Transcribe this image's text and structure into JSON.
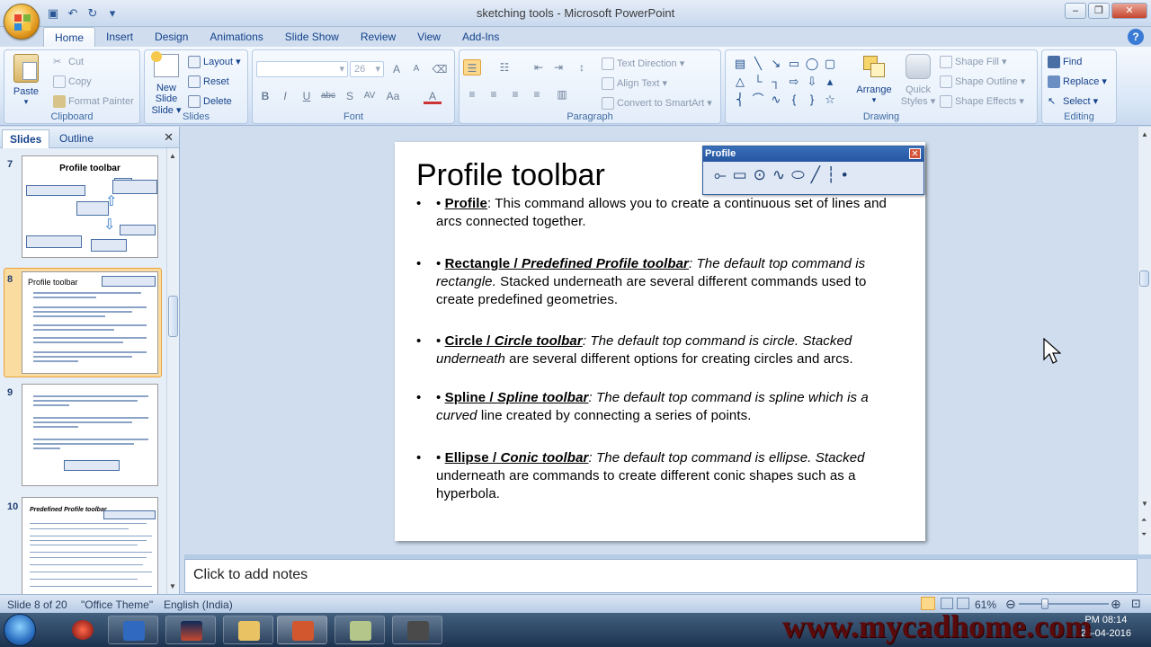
{
  "window": {
    "title": "sketching tools - Microsoft PowerPoint"
  },
  "tabs": [
    "Home",
    "Insert",
    "Design",
    "Animations",
    "Slide Show",
    "Review",
    "View",
    "Add-Ins"
  ],
  "active_tab": "Home",
  "ribbon": {
    "clipboard": {
      "label": "Clipboard",
      "paste": "Paste",
      "cut": "Cut",
      "copy": "Copy",
      "format_painter": "Format Painter"
    },
    "slides": {
      "label": "Slides",
      "new_slide": "New Slide",
      "new_slide_2": "Slide",
      "layout": "Layout",
      "reset": "Reset",
      "delete": "Delete"
    },
    "font": {
      "label": "Font",
      "font_name": "",
      "font_size": "26"
    },
    "paragraph": {
      "label": "Paragraph",
      "text_direction": "Text Direction",
      "align_text": "Align Text",
      "convert_smartart": "Convert to SmartArt"
    },
    "drawing": {
      "label": "Drawing",
      "arrange": "Arrange",
      "quick_styles": "Quick",
      "quick_styles_2": "Styles",
      "shape_fill": "Shape Fill",
      "shape_outline": "Shape Outline",
      "shape_effects": "Shape Effects"
    },
    "editing": {
      "label": "Editing",
      "find": "Find",
      "replace": "Replace",
      "select": "Select"
    }
  },
  "left_pane": {
    "tabs": [
      "Slides",
      "Outline"
    ],
    "slides": [
      {
        "num": "7",
        "title": "Profile toolbar"
      },
      {
        "num": "8",
        "title": "Profile toolbar"
      },
      {
        "num": "9",
        "title": ""
      },
      {
        "num": "10",
        "title": "Predefined Profile toolbar"
      }
    ]
  },
  "slide": {
    "title": "Profile toolbar",
    "bullets": [
      {
        "term": "Profile",
        "text_parts": [
          ": This command allows you to create a continuous set of lines and arcs connected together."
        ]
      },
      {
        "term": "Rectangle / ",
        "term_i": "Predefined Profile toolbar",
        "italic": ": The default top command is rectangle.",
        "text": " Stacked underneath are several different commands used to create predefined geometries."
      },
      {
        "term": "Circle / ",
        "term_i": "Circle toolbar",
        "italic": ": The default top command is circle. Stacked underneath",
        "text": " are several different options for creating circles and arcs."
      },
      {
        "term": "Spline / ",
        "term_i": "Spline toolbar",
        "italic": ": The default top command is spline which is a curved",
        "text": " line created by connecting a series of points."
      },
      {
        "term": "Ellipse / ",
        "term_i": "Conic toolbar",
        "italic": ": The default top command is ellipse. Stacked",
        "text": " underneath are commands to create different conic shapes such as a hyperbola."
      }
    ]
  },
  "floating_toolbar": {
    "title": "Profile"
  },
  "notes": {
    "placeholder": "Click to add notes"
  },
  "status": {
    "slide": "Slide 8 of 20",
    "theme": "\"Office Theme\"",
    "language": "English (India)",
    "zoom": "61%"
  },
  "taskbar": {
    "watermark": "www.mycadhome.com",
    "time": "PM 08:14",
    "date": "25-04-2016"
  },
  "colors": {
    "ribbon": "#dbe7f6",
    "selection": "#f8b24b",
    "title_bar": "#c9d9ee"
  }
}
